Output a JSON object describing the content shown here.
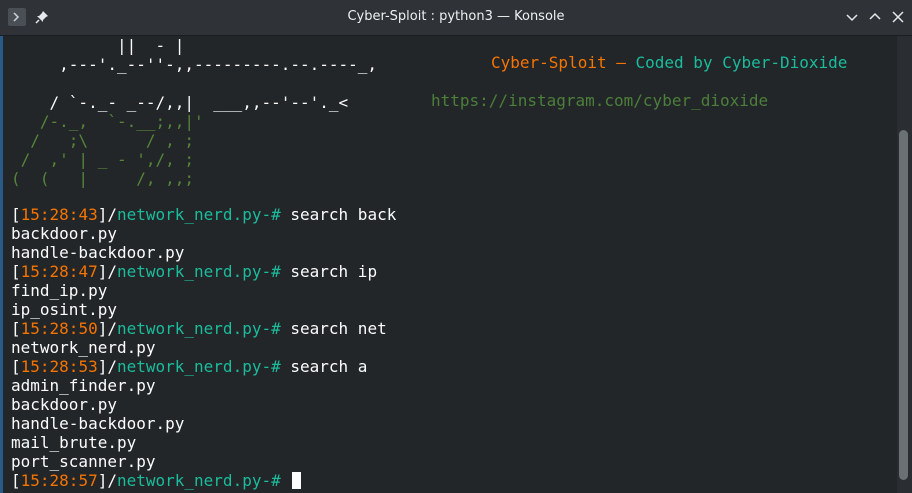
{
  "window": {
    "title": "Cyber-Sploit : python3 — Konsole",
    "icons": [
      "konsole-icon",
      "pin-icon",
      "minimize-icon",
      "maximize-icon",
      "close-icon"
    ]
  },
  "banner": {
    "art_lines": [
      "           ||  - |",
      "     ,---'._--''-,,---------.--.----_,",
      "",
      "    / `-._- _--/,,|  ___,,--'--'._<",
      "   /-._,  `-.__;,,|'",
      "  /   ;\\      / , ;",
      " /  ,' | _ - ',/, ;",
      "(  (   |     /, ,,;"
    ],
    "tagline_name": "Cyber-Sploit",
    "tagline_dash": " – ",
    "tagline_rest": "Coded by Cyber-Dioxide",
    "url": "https://instagram.com/cyber_dioxide"
  },
  "prompt": {
    "path": "network_nerd.py",
    "suffix": "-# "
  },
  "session": [
    {
      "time": "15:28:43",
      "command": "search back",
      "results": [
        "backdoor.py",
        "handle-backdoor.py"
      ]
    },
    {
      "time": "15:28:47",
      "command": "search ip",
      "results": [
        "find_ip.py",
        "ip_osint.py"
      ]
    },
    {
      "time": "15:28:50",
      "command": "search net",
      "results": [
        "network_nerd.py"
      ]
    },
    {
      "time": "15:28:53",
      "command": "search a",
      "results": [
        "admin_finder.py",
        "backdoor.py",
        "handle-backdoor.py",
        "mail_brute.py",
        "port_scanner.py"
      ]
    },
    {
      "time": "15:28:57",
      "command": "",
      "results": []
    }
  ],
  "colors": {
    "background": "#232629",
    "timestamp": "#f67400",
    "path": "#1abc9c",
    "art_green": "#55863a",
    "text": "#fcfcfc"
  }
}
